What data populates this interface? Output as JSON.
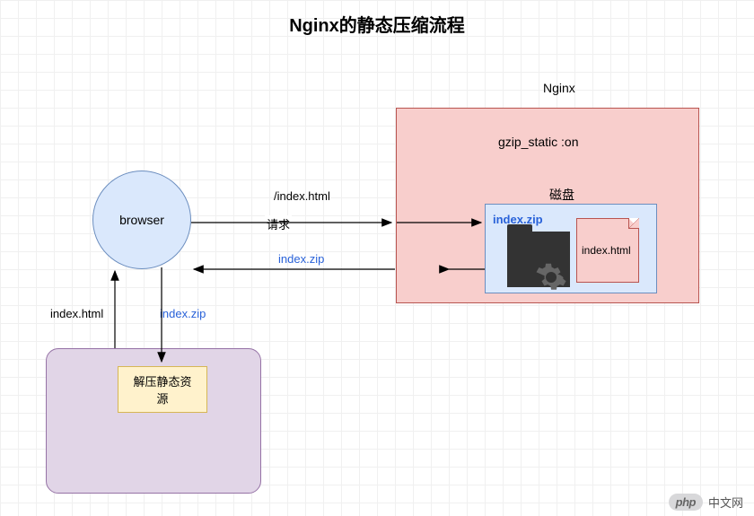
{
  "title": "Nginx的静态压缩流程",
  "nginx": {
    "label": "Nginx",
    "config": "gzip_static :on",
    "disk_label": "磁盘",
    "zip_file": "index.zip",
    "html_file": "index.html"
  },
  "browser": {
    "label": "browser"
  },
  "arrows": {
    "request_path": "/index.html",
    "request_label": "请求",
    "response_label": "index.zip",
    "to_decompress": "index.zip",
    "from_decompress": "index.html"
  },
  "decompress": {
    "label": "解压静态资\n源"
  },
  "watermark": {
    "badge": "php",
    "text": "中文网"
  }
}
